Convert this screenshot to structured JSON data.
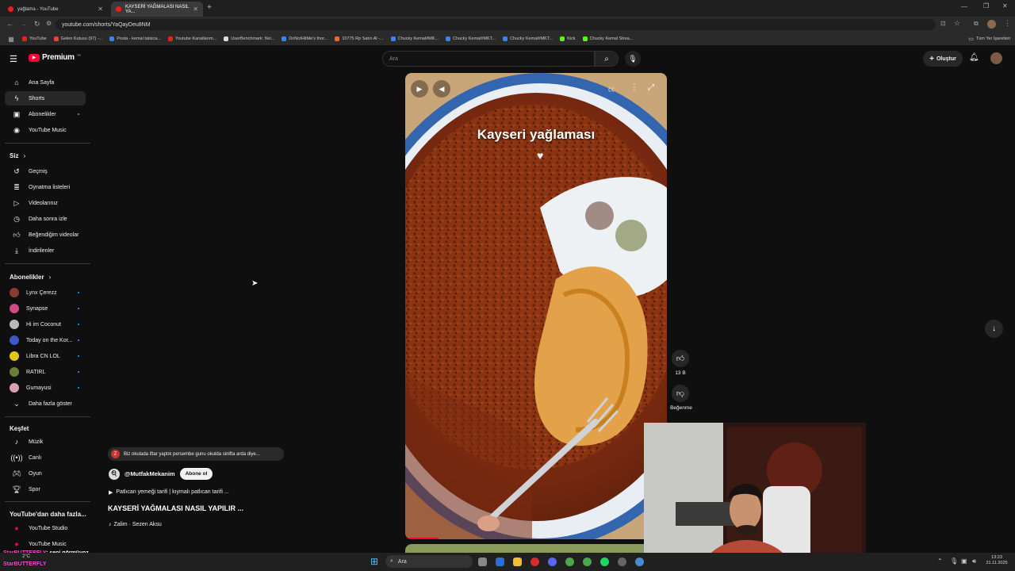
{
  "browser": {
    "tabs": [
      {
        "title": "yağlama - YouTube",
        "active": false
      },
      {
        "title": "KAYSERİ YAĞMALASI NASIL YA...",
        "active": true
      }
    ],
    "new_tab": "+",
    "url": "youtube.com/shorts/YaQayDeu8NM",
    "bookmarks": [
      "YouTube",
      "Gelen Kutusu (97) -...",
      "Posta - kemal tatsica...",
      "Youtube Kanallarım...",
      "UserBenchmark: Nvi...",
      "DoNotHitMe's thor...",
      "10775 Rp Satın Al -...",
      "Chucky Kemal#MK...",
      "Chucky Kemal#MKT...",
      "Chucky Kemal#MKT...",
      "Kick",
      "Chucky Kemal Strea..."
    ],
    "all_bookmarks": "Tüm Yer İşaretleri"
  },
  "header": {
    "logo": "Premium",
    "logo_sup": "TR",
    "search_placeholder": "Ara",
    "create_label": "Oluştur"
  },
  "sidebar": {
    "main": [
      {
        "label": "Ana Sayfa",
        "icon": "home-icon"
      },
      {
        "label": "Shorts",
        "icon": "shorts-icon",
        "active": true
      },
      {
        "label": "Abonelikler",
        "icon": "subscriptions-icon"
      },
      {
        "label": "YouTube Music",
        "icon": "music-icon"
      }
    ],
    "you_title": "Siz",
    "you": [
      {
        "label": "Geçmiş",
        "icon": "history-icon"
      },
      {
        "label": "Oynatma listeleri",
        "icon": "playlist-icon"
      },
      {
        "label": "Videolarınız",
        "icon": "video-icon"
      },
      {
        "label": "Daha sonra izle",
        "icon": "clock-icon"
      },
      {
        "label": "Beğendiğim videolar",
        "icon": "like-icon"
      },
      {
        "label": "İndirilenler",
        "icon": "download-icon"
      }
    ],
    "subs_title": "Abonelikler",
    "subs": [
      {
        "label": "Lynx Çerezz",
        "color": "#8a3b2f"
      },
      {
        "label": "Synapse",
        "color": "#d14b86"
      },
      {
        "label": "Hi im Coconut",
        "color": "#b9b9b9"
      },
      {
        "label": "Today on the Kor...",
        "color": "#3e56c9"
      },
      {
        "label": "Libra CN LOL",
        "color": "#e5c51a"
      },
      {
        "label": "RATIRL",
        "color": "#6b7d3b"
      },
      {
        "label": "Gumayusi",
        "color": "#d8a0b5"
      }
    ],
    "show_more": "Daha fazla göster",
    "explore_title": "Keşfet",
    "explore": [
      {
        "label": "Müzik",
        "icon": "music-note-icon"
      },
      {
        "label": "Canlı",
        "icon": "live-icon"
      },
      {
        "label": "Oyun",
        "icon": "gamepad-icon"
      },
      {
        "label": "Spor",
        "icon": "trophy-icon"
      }
    ],
    "more_title": "YouTube'dan daha fazla...",
    "more": [
      {
        "label": "YouTube Studio"
      },
      {
        "label": "YouTube Music"
      }
    ]
  },
  "short": {
    "overlay_title": "Kayseri yağlaması",
    "comment_avatar": "Z",
    "comment": "Biz okulada iftar yaptık persembe gunu okulda sinifta arda diye...",
    "channel": "@MutfakMekanim",
    "subscribe": "Abone ol",
    "playlist": "Patlıcan yemeği tarifi | kıymalı patlıcan tarifi ...",
    "title": "KAYSERİ YAĞMALASI NASIL YAPILIR ...",
    "music": "Zalim · Sezen Aksu",
    "likes": "13 B",
    "dislike_label": "Beğenme"
  },
  "chat": {
    "user": "StarBUTTERFLY",
    "message": ": seni görmüyoz",
    "user2": "StarBUTTERFLY"
  },
  "taskbar": {
    "search": "Ara",
    "time": "13:23",
    "date": "21.11.2025",
    "weather": "2°C"
  },
  "colors": {
    "brand": "#ff0033",
    "bg": "#0f0f0f",
    "accent": "#3ea6ff"
  }
}
